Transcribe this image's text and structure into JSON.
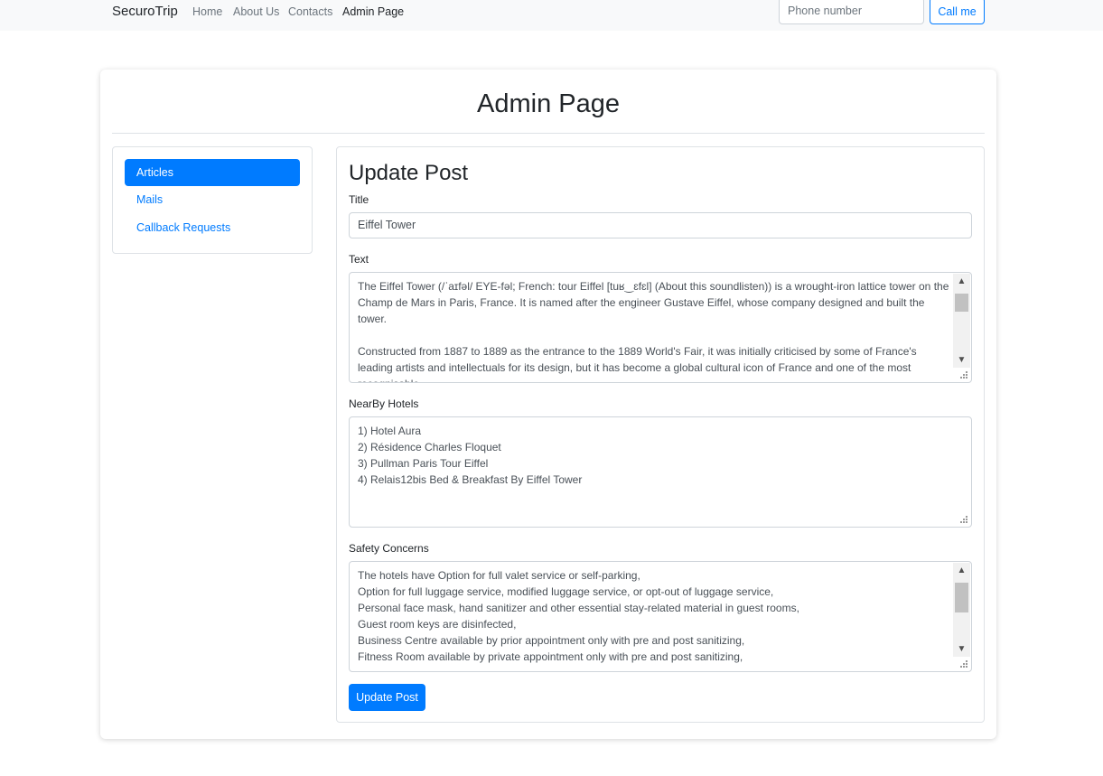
{
  "navbar": {
    "brand": "SecuroTrip",
    "links": [
      {
        "label": "Home"
      },
      {
        "label": "About Us"
      },
      {
        "label": "Contacts"
      },
      {
        "label": "Admin Page",
        "active": true
      }
    ],
    "phone_placeholder": "Phone number",
    "call_label": "Call me"
  },
  "page": {
    "title": "Admin Page"
  },
  "sidebar": {
    "items": [
      {
        "label": "Articles",
        "active": true
      },
      {
        "label": "Mails"
      },
      {
        "label": "Callback Requests"
      }
    ]
  },
  "form": {
    "heading": "Update Post",
    "title_label": "Title",
    "title_value": "Eiffel Tower",
    "text_label": "Text",
    "text_value": "The Eiffel Tower (/ˈaɪfəl/ EYE-fəl; French: tour Eiffel [tuʁ‿ɛfɛl] (About this soundlisten)) is a wrought-iron lattice tower on the Champ de Mars in Paris, France. It is named after the engineer Gustave Eiffel, whose company designed and built the tower.\n\nConstructed from 1887 to 1889 as the entrance to the 1889 World's Fair, it was initially criticised by some of France's leading artists and intellectuals for its design, but it has become a global cultural icon of France and one of the most recognisable",
    "hotels_label": "NearBy Hotels",
    "hotels_value": "1) Hotel Aura\n2) Résidence Charles Floquet\n3) Pullman Paris Tour Eiffel\n4) Relais12bis Bed & Breakfast By Eiffel Tower",
    "safety_label": "Safety Concerns",
    "safety_value": "The hotels have Option for full valet service or self-parking,\nOption for full luggage service, modified luggage service, or opt-out of luggage service,\nPersonal face mask, hand sanitizer and other essential stay-related material in guest rooms,\nGuest room keys are disinfected,\nBusiness Centre available by prior appointment only with pre and post sanitizing,\nFitness Room available by private appointment only with pre and post sanitizing,",
    "submit_label": "Update Post"
  },
  "colors": {
    "primary": "#007bff",
    "navbar_bg": "#f8f9fa",
    "border": "#dee2e6"
  },
  "icons": {
    "scroll_up": "chevron-up-icon",
    "scroll_down": "chevron-down-icon",
    "resize": "resize-grip-icon"
  }
}
